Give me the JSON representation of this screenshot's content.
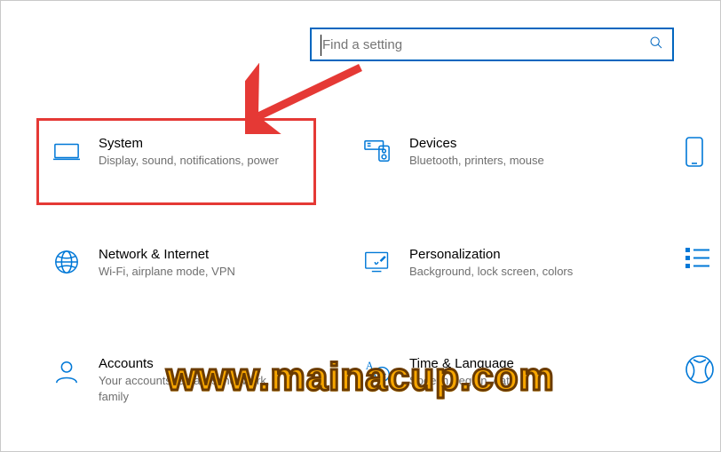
{
  "search": {
    "placeholder": "Find a setting"
  },
  "tiles": {
    "system": {
      "title": "System",
      "desc": "Display, sound, notifications, power"
    },
    "devices": {
      "title": "Devices",
      "desc": "Bluetooth, printers, mouse"
    },
    "network": {
      "title": "Network & Internet",
      "desc": "Wi-Fi, airplane mode, VPN"
    },
    "personalization": {
      "title": "Personalization",
      "desc": "Background, lock screen, colors"
    },
    "accounts": {
      "title": "Accounts",
      "desc": "Your accounts, email, sync, work, family"
    },
    "time": {
      "title": "Time & Language",
      "desc": "Speech, region, date"
    }
  },
  "watermark": "www.mainacup.com",
  "colors": {
    "accent": "#0078d7",
    "highlight": "#e53935",
    "watermark_fill": "#f7a600",
    "watermark_stroke": "#6b3b00"
  }
}
